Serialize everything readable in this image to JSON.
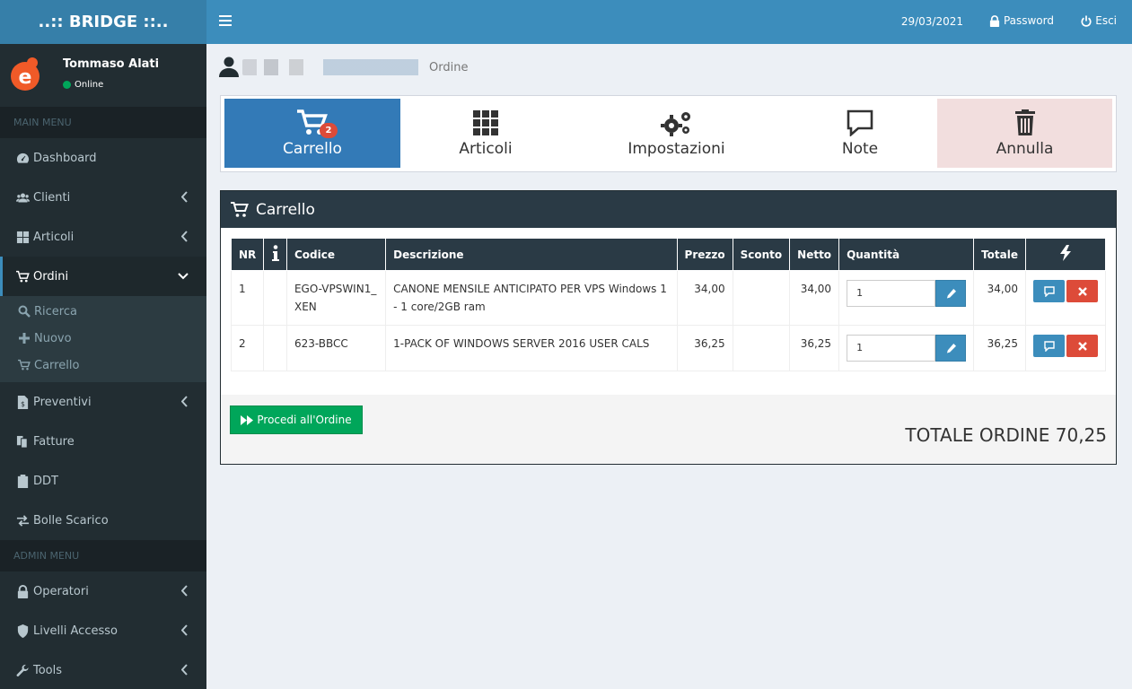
{
  "app": {
    "logo": "..:: BRIDGE ::.."
  },
  "user": {
    "name": "Tommaso Alati",
    "status": "Online"
  },
  "sidebar": {
    "main_header": "MAIN MENU",
    "admin_header": "ADMIN MENU",
    "items": [
      {
        "label": "Dashboard"
      },
      {
        "label": "Clienti"
      },
      {
        "label": "Articoli"
      },
      {
        "label": "Ordini"
      },
      {
        "label": "Preventivi"
      },
      {
        "label": "Fatture"
      },
      {
        "label": "DDT"
      },
      {
        "label": "Bolle Scarico"
      }
    ],
    "submenu": [
      {
        "label": "Ricerca"
      },
      {
        "label": "Nuovo"
      },
      {
        "label": "Carrello"
      }
    ],
    "admin_items": [
      {
        "label": "Operatori"
      },
      {
        "label": "Livelli Accesso"
      },
      {
        "label": "Tools"
      }
    ]
  },
  "topbar": {
    "date": "29/03/2021",
    "password": "Password",
    "exit": "Esci"
  },
  "page": {
    "subtitle": "Ordine"
  },
  "actions": {
    "cart": "Carrello",
    "cart_count": "2",
    "articles": "Articoli",
    "settings": "Impostazioni",
    "notes": "Note",
    "cancel": "Annulla"
  },
  "cart": {
    "title": "Carrello",
    "columns": [
      "NR",
      "Codice",
      "Descrizione",
      "Prezzo",
      "Sconto",
      "Netto",
      "Quantità",
      "Totale"
    ],
    "rows": [
      {
        "nr": "1",
        "code": "EGO-VPSWIN1_XEN",
        "desc": "CANONE MENSILE ANTICIPATO PER VPS Windows 1 - 1 core/2GB ram",
        "price": "34,00",
        "discount": "",
        "net": "34,00",
        "qty": "1",
        "total": "34,00"
      },
      {
        "nr": "2",
        "code": "623-BBCC",
        "desc": "1-PACK OF WINDOWS SERVER 2016 USER CALS",
        "price": "36,25",
        "discount": "",
        "net": "36,25",
        "qty": "1",
        "total": "36,25"
      }
    ],
    "proceed": "Procedi all'Ordine",
    "total": "TOTALE ORDINE 70,25"
  },
  "colors": {
    "accent": "#3c8dbc",
    "sidebar": "#222d32",
    "success": "#00a65a",
    "danger": "#dd4b39"
  }
}
